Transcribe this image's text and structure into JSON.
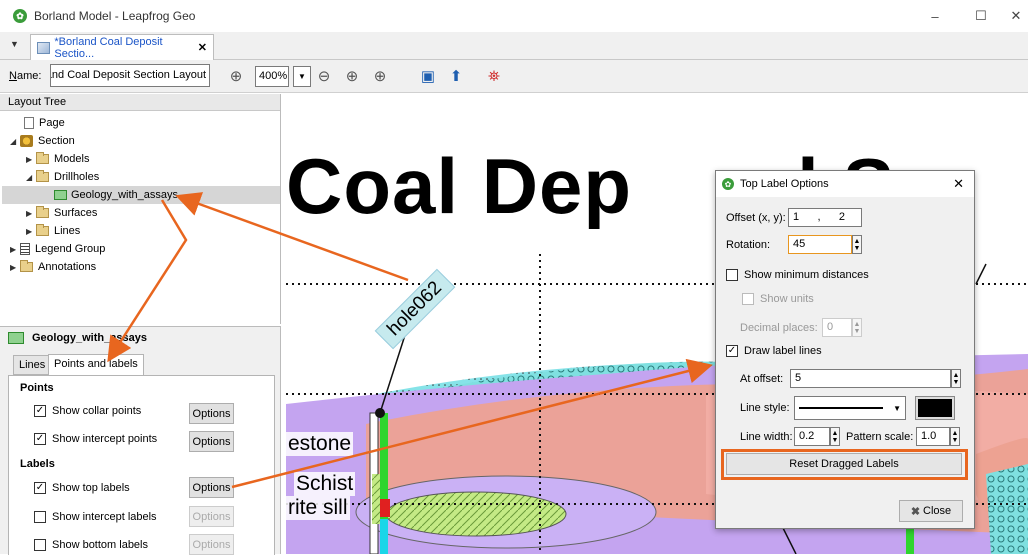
{
  "window": {
    "title": "Borland Model - Leapfrog Geo",
    "minimize": "–",
    "maximize": "☐",
    "close": "✕"
  },
  "doc_tab": {
    "label": "*Borland Coal Deposit Sectio...",
    "close": "✕"
  },
  "toolbar": {
    "name_label": "Name:",
    "name_value": "Borland Coal Deposit Section Layout",
    "zoom": "400%"
  },
  "layout_tree": {
    "header": "Layout Tree",
    "items": [
      "Page",
      "Section",
      "Models",
      "Drillholes",
      "Geology_with_assays",
      "Surfaces",
      "Lines",
      "Legend Group",
      "Annotations"
    ]
  },
  "props": {
    "title": "Geology_with_assays",
    "tabs": [
      "Lines",
      "Points and labels"
    ],
    "points_header": "Points",
    "labels_header": "Labels",
    "show_collar": "Show collar points",
    "show_intercept": "Show intercept points",
    "show_top": "Show top labels",
    "show_intercept_labels": "Show intercept labels",
    "show_bottom": "Show bottom labels",
    "options": "Options"
  },
  "canvas": {
    "title": "Coal Dep",
    "title_tail": "l S",
    "hole_label": "hole062",
    "rocks": [
      "estone",
      "Schist",
      "rite sill"
    ]
  },
  "dialog": {
    "title": "Top Label Options",
    "offset_label": "Offset (x, y):",
    "offset_x": "1",
    "offset_y": "2",
    "rotation_label": "Rotation:",
    "rotation": "45",
    "show_min": "Show minimum distances",
    "show_units": "Show units",
    "decimal_label": "Decimal places:",
    "decimal": "0",
    "draw_label_lines": "Draw label lines",
    "at_offset_label": "At offset:",
    "at_offset": "5",
    "line_style_label": "Line style:",
    "line_width_label": "Line width:",
    "line_width": "0.2",
    "pattern_scale_label": "Pattern scale:",
    "pattern_scale": "1.0",
    "reset": "Reset Dragged Labels",
    "close": "Close"
  },
  "colors": {
    "annotation_arrow": "#e8661f",
    "highlight": "#e8661f",
    "selection": "#d6d6d6"
  }
}
